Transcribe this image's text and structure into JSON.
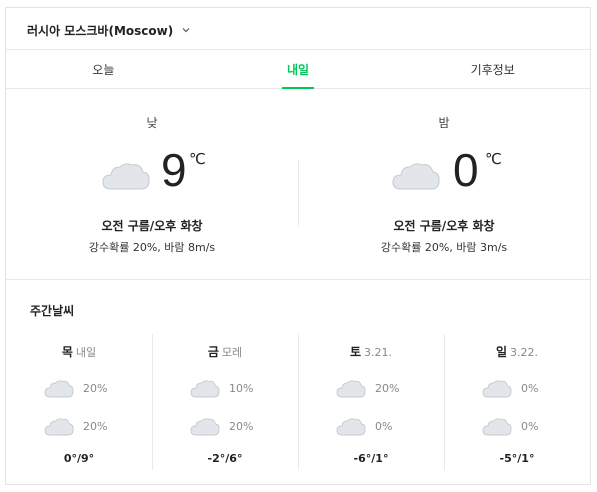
{
  "location": {
    "label": "러시아 모스크바(Moscow)",
    "dropdown_icon": "chevron-down-icon"
  },
  "tabs": [
    {
      "label": "오늘",
      "active": false
    },
    {
      "label": "내일",
      "active": true
    },
    {
      "label": "기후정보",
      "active": false
    }
  ],
  "accent_color": "#03c75a",
  "day": {
    "period": "낮",
    "icon": "cloudy-icon",
    "temp": "9",
    "unit": "℃",
    "desc": "오전 구름/오후 화창",
    "sub": "강수확률 20%, 바람 8m/s"
  },
  "night": {
    "period": "밤",
    "icon": "cloudy-icon",
    "temp": "0",
    "unit": "℃",
    "desc": "오전 구름/오후 화창",
    "sub": "강수확률 20%, 바람 3m/s"
  },
  "weekly": {
    "title": "주간날씨",
    "days": [
      {
        "day": "목",
        "date": "내일",
        "am_icon": "cloudy-icon",
        "am_rain": "20%",
        "pm_icon": "cloudy-icon",
        "pm_rain": "20%",
        "minmax": "0°/9°"
      },
      {
        "day": "금",
        "date": "모레",
        "am_icon": "cloudy-icon",
        "am_rain": "10%",
        "pm_icon": "cloudy-icon",
        "pm_rain": "20%",
        "minmax": "-2°/6°"
      },
      {
        "day": "토",
        "date": "3.21.",
        "am_icon": "cloudy-icon",
        "am_rain": "20%",
        "pm_icon": "cloudy-icon",
        "pm_rain": "0%",
        "minmax": "-6°/1°"
      },
      {
        "day": "일",
        "date": "3.22.",
        "am_icon": "cloudy-icon",
        "am_rain": "0%",
        "pm_icon": "cloudy-icon",
        "pm_rain": "0%",
        "minmax": "-5°/1°"
      }
    ]
  }
}
